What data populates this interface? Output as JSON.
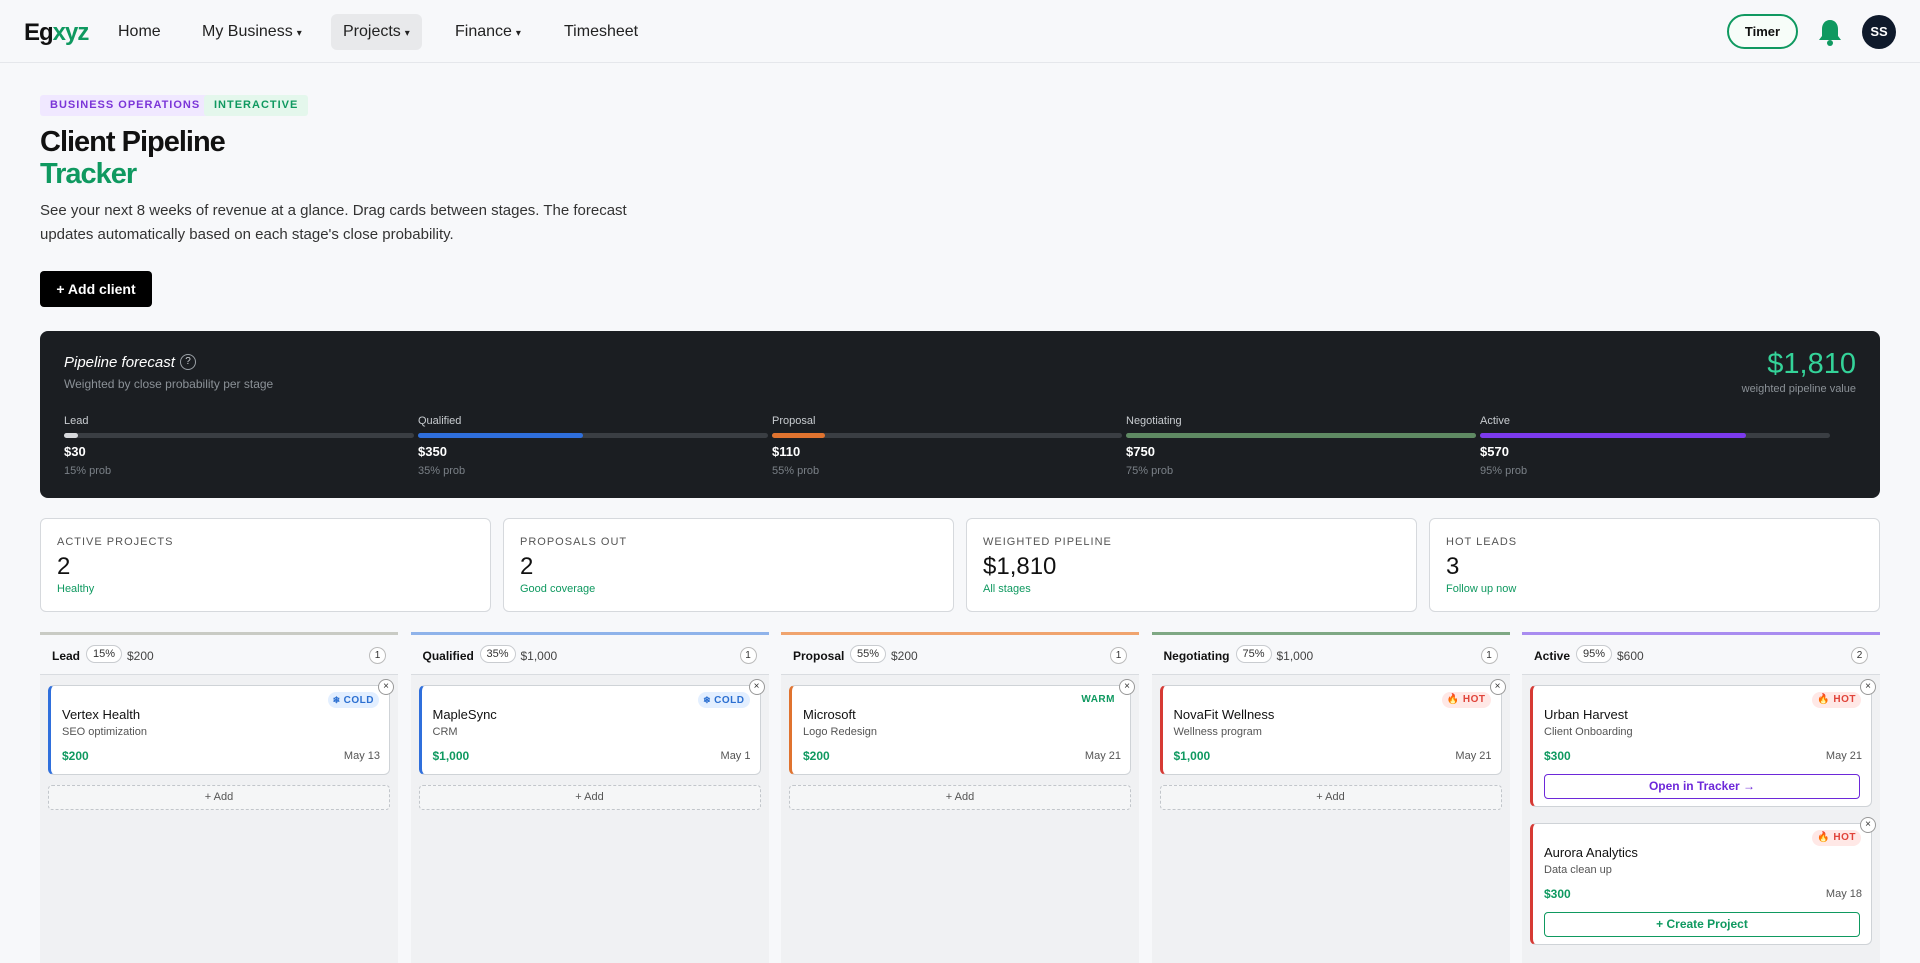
{
  "nav": {
    "logo_a": "Eg",
    "logo_b": "xyz",
    "links": [
      {
        "label": "Home"
      },
      {
        "label": "My Business",
        "caret": "▾"
      },
      {
        "label": "Projects",
        "caret": "▾"
      },
      {
        "label": "Finance",
        "caret": "▾"
      },
      {
        "label": "Timesheet"
      }
    ],
    "timer_label": "Timer",
    "bell_icon": "bell-icon",
    "avatar_initials": "SS",
    "accent": "#0f9960"
  },
  "header": {
    "tags": [
      "BUSINESS OPERATIONS",
      "INTERACTIVE"
    ],
    "title_line1": "Client Pipeline",
    "title_line2": "Tracker",
    "subtitle": "See your next 8 weeks of revenue at a glance. Drag cards between stages. The forecast updates automatically based on each stage's close probability.",
    "add_client_label": "+ Add client"
  },
  "forecast": {
    "title": "Pipeline forecast",
    "help_label": "?",
    "subtitle": "Weighted by close probability per stage",
    "total": "$1,810",
    "total_label": "weighted pipeline value",
    "stages": [
      {
        "name": "Lead",
        "value": "$30",
        "prob": "15% prob",
        "fill_pct": 4,
        "color": "#d7d9dc"
      },
      {
        "name": "Qualified",
        "value": "$350",
        "prob": "35% prob",
        "fill_pct": 47,
        "color": "#2f6fdc"
      },
      {
        "name": "Proposal",
        "value": "$110",
        "prob": "55% prob",
        "fill_pct": 15,
        "color": "#e0732f"
      },
      {
        "name": "Negotiating",
        "value": "$750",
        "prob": "75% prob",
        "fill_pct": 100,
        "color": "#5f8a63"
      },
      {
        "name": "Active",
        "value": "$570",
        "prob": "95% prob",
        "fill_pct": 76,
        "color": "#7c3aed"
      }
    ]
  },
  "stats": [
    {
      "label": "ACTIVE PROJECTS",
      "value": "2",
      "sub": "Healthy"
    },
    {
      "label": "PROPOSALS OUT",
      "value": "2",
      "sub": "Good coverage"
    },
    {
      "label": "WEIGHTED PIPELINE",
      "value": "$1,810",
      "sub": "All stages"
    },
    {
      "label": "HOT LEADS",
      "value": "3",
      "sub": "Follow up now"
    }
  ],
  "columns": [
    {
      "name": "Lead",
      "pct": "15%",
      "amount": "$200",
      "count": "1",
      "color": "#c9cbc4",
      "cards": [
        {
          "name": "Vertex Health",
          "desc": "SEO optimization",
          "amount": "$200",
          "date": "May 13",
          "badge": "COLD",
          "badge_type": "cold",
          "border": "#2f6fdc"
        }
      ],
      "add_label": "+ Add"
    },
    {
      "name": "Qualified",
      "pct": "35%",
      "amount": "$1,000",
      "count": "1",
      "color": "#8fb3ea",
      "cards": [
        {
          "name": "MapleSync",
          "desc": "CRM",
          "amount": "$1,000",
          "date": "May 1",
          "badge": "COLD",
          "badge_type": "cold",
          "border": "#2f6fdc"
        }
      ],
      "add_label": "+ Add"
    },
    {
      "name": "Proposal",
      "pct": "55%",
      "amount": "$200",
      "count": "1",
      "color": "#f0a46e",
      "cards": [
        {
          "name": "Microsoft",
          "desc": "Logo Redesign",
          "amount": "$200",
          "date": "May 21",
          "badge": "WARM",
          "badge_type": "warm",
          "border": "#e0732f"
        }
      ],
      "add_label": "+ Add"
    },
    {
      "name": "Negotiating",
      "pct": "75%",
      "amount": "$1,000",
      "count": "1",
      "color": "#7fa884",
      "cards": [
        {
          "name": "NovaFit Wellness",
          "desc": "Wellness program",
          "amount": "$1,000",
          "date": "May 21",
          "badge": "🔥 HOT",
          "badge_type": "hot",
          "border": "#d63a34"
        }
      ],
      "add_label": "+ Add"
    },
    {
      "name": "Active",
      "pct": "95%",
      "amount": "$600",
      "count": "2",
      "color": "#a98cf0",
      "cards": [
        {
          "name": "Urban Harvest",
          "desc": "Client Onboarding",
          "amount": "$300",
          "date": "May 21",
          "badge": "🔥 HOT",
          "badge_type": "hot",
          "border": "#d63a34",
          "action": "Open in Tracker →",
          "action_color": "#6d28d9"
        },
        {
          "name": "Aurora Analytics",
          "desc": "Data clean up",
          "amount": "$300",
          "date": "May 18",
          "badge": "🔥 HOT",
          "badge_type": "hot",
          "border": "#d63a34",
          "action": "+ Create Project",
          "action_color": "#0f9960"
        }
      ]
    }
  ]
}
